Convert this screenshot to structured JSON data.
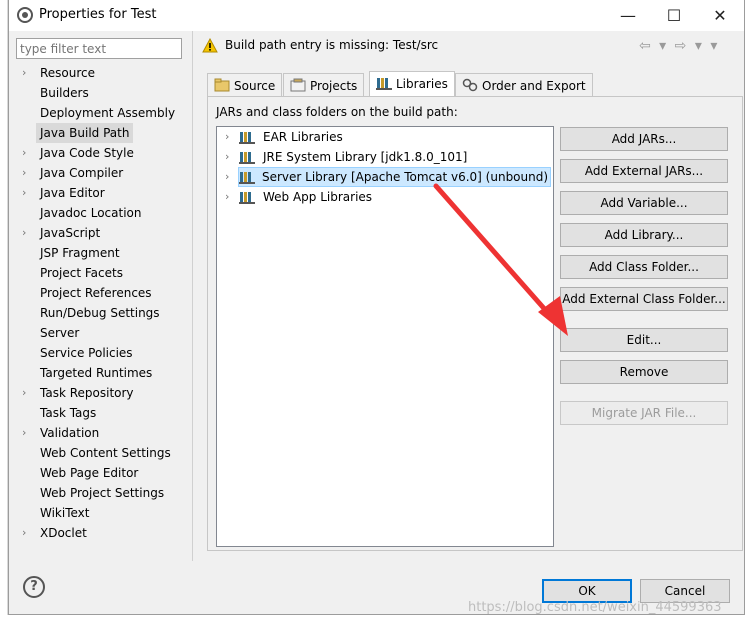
{
  "window": {
    "title": "Properties for Test",
    "minimize_glyph": "—",
    "maximize_glyph": "☐",
    "close_glyph": "✕"
  },
  "filter": {
    "placeholder": "type filter text"
  },
  "tree": {
    "items": [
      {
        "label": "Resource",
        "expandable": true
      },
      {
        "label": "Builders",
        "expandable": false
      },
      {
        "label": "Deployment Assembly",
        "expandable": false
      },
      {
        "label": "Java Build Path",
        "expandable": false,
        "selected": true
      },
      {
        "label": "Java Code Style",
        "expandable": true
      },
      {
        "label": "Java Compiler",
        "expandable": true
      },
      {
        "label": "Java Editor",
        "expandable": true
      },
      {
        "label": "Javadoc Location",
        "expandable": false
      },
      {
        "label": "JavaScript",
        "expandable": true
      },
      {
        "label": "JSP Fragment",
        "expandable": false
      },
      {
        "label": "Project Facets",
        "expandable": false
      },
      {
        "label": "Project References",
        "expandable": false
      },
      {
        "label": "Run/Debug Settings",
        "expandable": false
      },
      {
        "label": "Server",
        "expandable": false
      },
      {
        "label": "Service Policies",
        "expandable": false
      },
      {
        "label": "Targeted Runtimes",
        "expandable": false
      },
      {
        "label": "Task Repository",
        "expandable": true
      },
      {
        "label": "Task Tags",
        "expandable": false
      },
      {
        "label": "Validation",
        "expandable": true
      },
      {
        "label": "Web Content Settings",
        "expandable": false
      },
      {
        "label": "Web Page Editor",
        "expandable": false
      },
      {
        "label": "Web Project Settings",
        "expandable": false
      },
      {
        "label": "WikiText",
        "expandable": false
      },
      {
        "label": "XDoclet",
        "expandable": true
      }
    ]
  },
  "header": {
    "warning": "Build path entry is missing: Test/src",
    "nav_glyphs": "⇦ ▾ ⇨ ▾ ▾"
  },
  "tabs": [
    {
      "label": "Source",
      "icon": "source-folder-icon"
    },
    {
      "label": "Projects",
      "icon": "projects-icon"
    },
    {
      "label": "Libraries",
      "icon": "libraries-icon",
      "active": true
    },
    {
      "label": "Order and Export",
      "icon": "order-export-icon"
    }
  ],
  "libraries": {
    "label": "JARs and class folders on the build path:",
    "entries": [
      {
        "label": "EAR Libraries"
      },
      {
        "label": "JRE System Library [jdk1.8.0_101]"
      },
      {
        "label": "Server Library [Apache Tomcat v6.0] (unbound)",
        "selected": true
      },
      {
        "label": "Web App Libraries"
      }
    ]
  },
  "buttons": {
    "add_jars": "Add JARs...",
    "add_external_jars": "Add External JARs...",
    "add_variable": "Add Variable...",
    "add_library": "Add Library...",
    "add_class_folder": "Add Class Folder...",
    "add_external_class_folder": "Add External Class Folder...",
    "edit": "Edit...",
    "remove": "Remove",
    "migrate_jar": "Migrate JAR File..."
  },
  "footer": {
    "help_glyph": "?",
    "ok": "OK",
    "cancel": "Cancel"
  },
  "watermark": "https://blog.csdn.net/weixin_44599363",
  "colors": {
    "selection": "#cce8ff",
    "tree_selection": "#d9d9d9",
    "arrow": "#ee3333",
    "default_button": "#0078d7"
  }
}
